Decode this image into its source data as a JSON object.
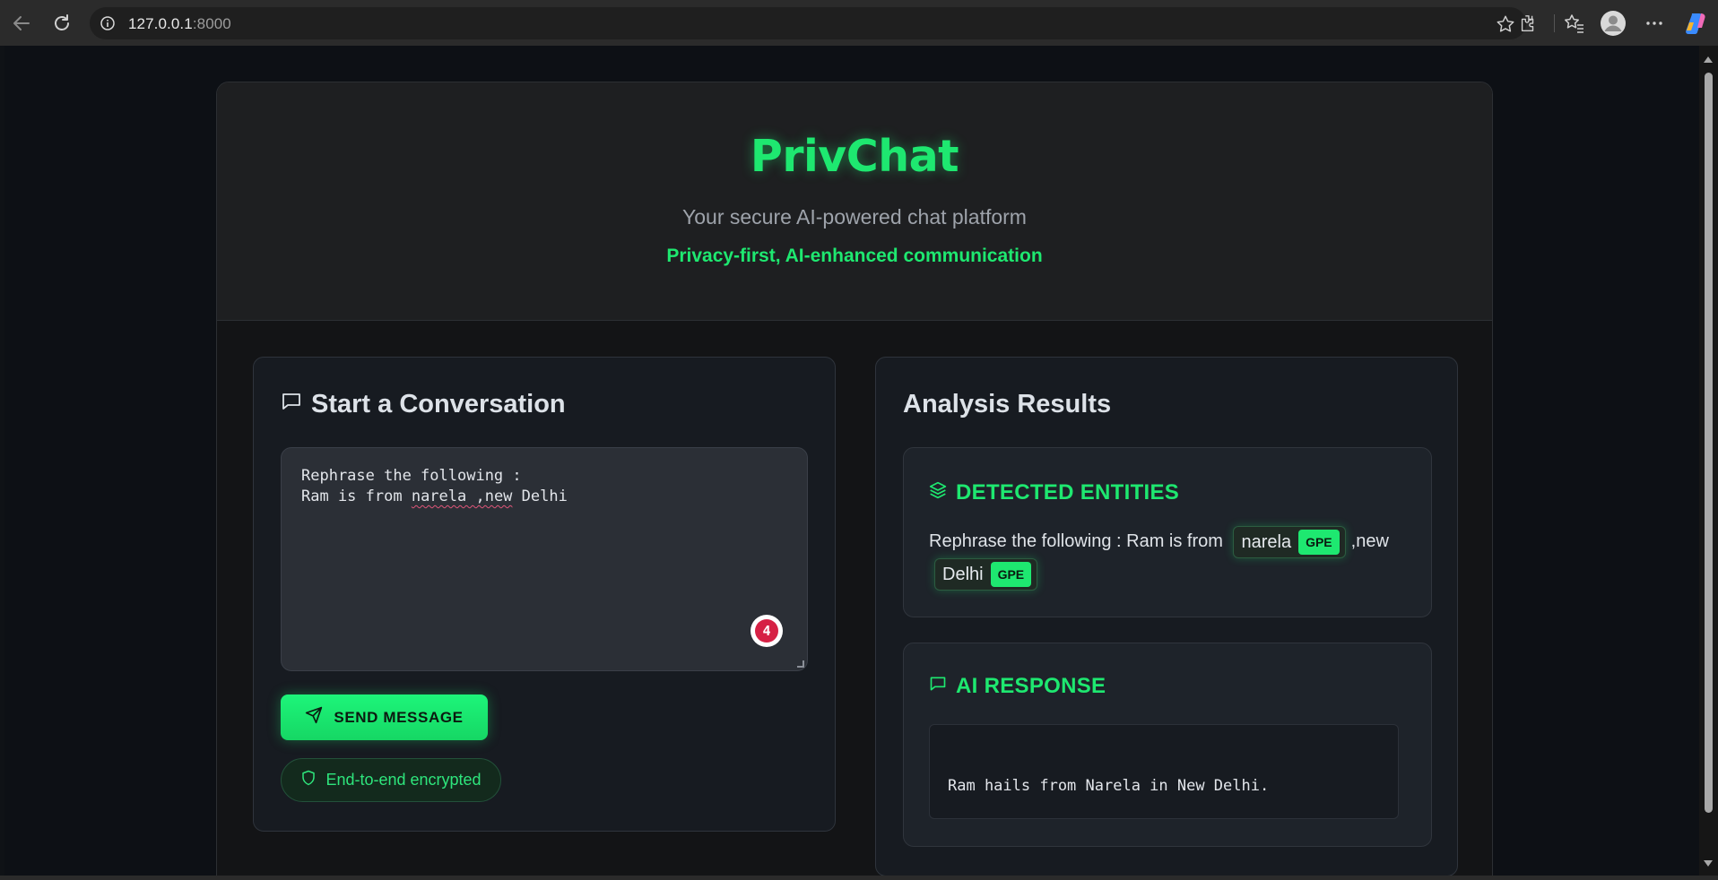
{
  "browser": {
    "url_host": "127.0.0.1",
    "url_port": ":8000"
  },
  "app": {
    "brand": "PrivChat",
    "tagline": "Your secure AI-powered chat platform",
    "subtagline": "Privacy-first, AI-enhanced communication"
  },
  "composer": {
    "title": "Start a Conversation",
    "line1": "Rephrase the following :",
    "line2_prefix": "Ram is from ",
    "line2_misspelled": "narela ,new",
    "line2_suffix": " Delhi",
    "grammar_count": "4",
    "send_label": "SEND MESSAGE",
    "encryption_label": "End-to-end encrypted"
  },
  "analysis": {
    "title": "Analysis Results",
    "entities_title": "DETECTED ENTITIES",
    "text_before": "Rephrase the following : Ram is from ",
    "entity1_text": "narela",
    "entity1_type": "GPE",
    "text_between": ",new",
    "entity2_text": "Delhi",
    "entity2_type": "GPE",
    "ai_title": "AI RESPONSE",
    "ai_response": "Ram hails from Narela in New Delhi."
  },
  "colors": {
    "accent": "#1ee870",
    "background": "#0d1015",
    "card": "#171b21"
  }
}
